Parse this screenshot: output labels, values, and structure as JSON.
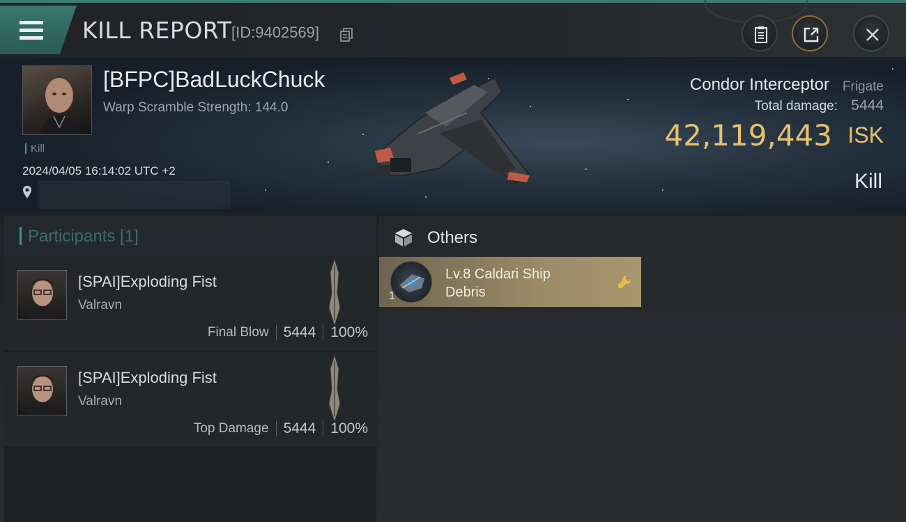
{
  "header": {
    "title": "KILL REPORT",
    "report_id": "[ID:9402569]",
    "icons": [
      "menu-icon",
      "copy-icon",
      "clipboard-icon",
      "share-icon",
      "close-icon"
    ]
  },
  "victim": {
    "name": "[BFPC]BadLuckChuck",
    "warp_scramble": "Warp Scramble Strength: 144.0",
    "tag": "Kill",
    "timestamp": "2024/04/05 16:14:02 UTC +2",
    "location": ""
  },
  "ship": {
    "name": "Condor Interceptor",
    "class": "Frigate",
    "total_damage_label": "Total damage:",
    "total_damage": "5444",
    "isk_value": "42,119,443",
    "isk_unit": "ISK",
    "result": "Kill"
  },
  "participants": {
    "header": "Participants [1]",
    "list": [
      {
        "name": "[SPAI]Exploding Fist",
        "corp": "Valravn",
        "role": "Final Blow",
        "damage": "5444",
        "percent": "100%"
      },
      {
        "name": "[SPAI]Exploding Fist",
        "corp": "Valravn",
        "role": "Top Damage",
        "damage": "5444",
        "percent": "100%"
      }
    ]
  },
  "others": {
    "header": "Others",
    "items": [
      {
        "name": "Lv.8 Caldari Ship Debris",
        "quantity": "1"
      }
    ]
  },
  "colors": {
    "accent_teal": "#3d7a72",
    "isk_gold": "#e5c170",
    "loot_gold": "#9a8a66"
  }
}
